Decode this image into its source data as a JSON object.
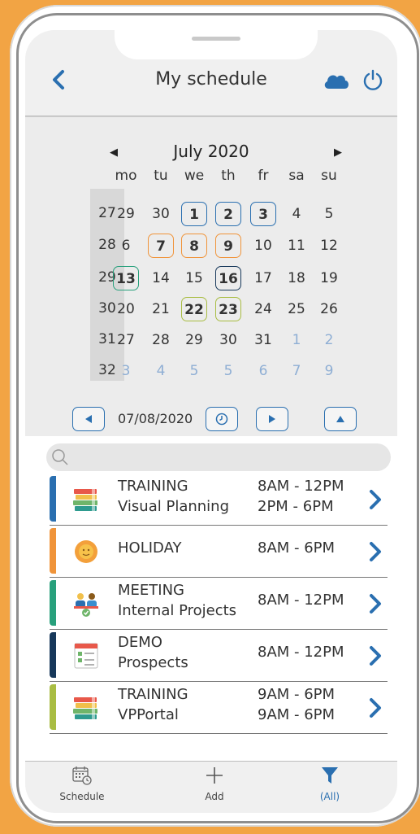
{
  "header": {
    "title": "My schedule"
  },
  "calendar": {
    "month_title": "July 2020",
    "weekdays": [
      "mo",
      "tu",
      "we",
      "th",
      "fr",
      "sa",
      "su"
    ],
    "weeks": [
      {
        "week": "27",
        "days": [
          {
            "d": "29",
            "other": false
          },
          {
            "d": "30",
            "other": false
          },
          {
            "d": "1",
            "mark": "blue"
          },
          {
            "d": "2",
            "mark": "blue"
          },
          {
            "d": "3",
            "mark": "blue"
          },
          {
            "d": "4"
          },
          {
            "d": "5"
          }
        ]
      },
      {
        "week": "28",
        "days": [
          {
            "d": "6"
          },
          {
            "d": "7",
            "mark": "orange"
          },
          {
            "d": "8",
            "mark": "orange"
          },
          {
            "d": "9",
            "mark": "orange"
          },
          {
            "d": "10"
          },
          {
            "d": "11"
          },
          {
            "d": "12"
          }
        ]
      },
      {
        "week": "29",
        "days": [
          {
            "d": "13",
            "mark": "teal"
          },
          {
            "d": "14"
          },
          {
            "d": "15"
          },
          {
            "d": "16",
            "mark": "navy"
          },
          {
            "d": "17"
          },
          {
            "d": "18"
          },
          {
            "d": "19"
          }
        ]
      },
      {
        "week": "30",
        "days": [
          {
            "d": "20"
          },
          {
            "d": "21"
          },
          {
            "d": "22",
            "mark": "olive"
          },
          {
            "d": "23",
            "mark": "olive"
          },
          {
            "d": "24"
          },
          {
            "d": "25"
          },
          {
            "d": "26"
          }
        ]
      },
      {
        "week": "31",
        "days": [
          {
            "d": "27"
          },
          {
            "d": "28"
          },
          {
            "d": "29"
          },
          {
            "d": "30"
          },
          {
            "d": "31"
          },
          {
            "d": "1",
            "other": true
          },
          {
            "d": "2",
            "other": true
          }
        ]
      },
      {
        "week": "32",
        "days": [
          {
            "d": "3",
            "other": true
          },
          {
            "d": "4",
            "other": true
          },
          {
            "d": "5",
            "other": true
          },
          {
            "d": "5",
            "other": true
          },
          {
            "d": "6",
            "other": true
          },
          {
            "d": "7",
            "other": true
          },
          {
            "d": "9",
            "other": true
          }
        ]
      }
    ],
    "selected_date": "07/08/2020"
  },
  "events": [
    {
      "type": "TRAINING",
      "subtitle": "Visual Planning",
      "time1": "8AM - 12PM",
      "time2": "2PM - 6PM",
      "color": "#2a6fb0",
      "icon": "books-icon"
    },
    {
      "type": "HOLIDAY",
      "subtitle": "",
      "time1": "8AM - 6PM",
      "time2": "",
      "color": "#f0943a",
      "icon": "sun-icon"
    },
    {
      "type": "MEETING",
      "subtitle": "Internal Projects",
      "time1": "8AM - 12PM",
      "time2": "",
      "color": "#28a07c",
      "icon": "meeting-icon"
    },
    {
      "type": "DEMO",
      "subtitle": "Prospects",
      "time1": "8AM - 12PM",
      "time2": "",
      "color": "#17385a",
      "icon": "checklist-icon"
    },
    {
      "type": "TRAINING",
      "subtitle": "VPPortal",
      "time1": "9AM - 6PM",
      "time2": "9AM - 6PM",
      "color": "#a9bd43",
      "icon": "books-icon"
    }
  ],
  "footer": {
    "schedule_label": "Schedule",
    "add_label": "Add",
    "filter_label": "(All)"
  },
  "colors": {
    "accent": "#2a6fb0",
    "background": "#f2a444"
  }
}
